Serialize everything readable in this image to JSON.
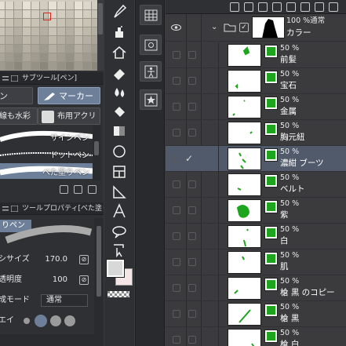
{
  "sub_tool_panel": {
    "title": "サブツール[ペン]"
  },
  "sub_tool_tabs": [
    {
      "label": "ン"
    },
    {
      "label": "マーカー"
    },
    {
      "label": "線も水彩"
    },
    {
      "label": "布用アクリ"
    }
  ],
  "brushes": [
    {
      "label": "サインペン"
    },
    {
      "label": "ドットペン"
    },
    {
      "label": "べた塗りペン"
    }
  ],
  "tool_property": {
    "title": "ツールプロパティ[べた塗りペン]",
    "preview_label": "りペン"
  },
  "properties": {
    "size_label": "シサイズ",
    "size_value": "170.0",
    "opacity_label": "透明度",
    "opacity_value": "100",
    "mode_label": "成モード",
    "mode_value": "通常",
    "aa_label": "エイ"
  },
  "folder": {
    "opacity": "100 %通常",
    "name": "カラー"
  },
  "layers": [
    {
      "opacity": "50 %",
      "name": "前髪",
      "selected": false
    },
    {
      "opacity": "50 %",
      "name": "宝石",
      "selected": false
    },
    {
      "opacity": "50 %",
      "name": "金属",
      "selected": false
    },
    {
      "opacity": "50 %",
      "name": "胸元紐",
      "selected": false
    },
    {
      "opacity": "50 %",
      "name": "濃紺 ブーツ",
      "selected": true
    },
    {
      "opacity": "50 %",
      "name": "ベルト",
      "selected": false
    },
    {
      "opacity": "50 %",
      "name": "紫",
      "selected": false
    },
    {
      "opacity": "50 %",
      "name": "白",
      "selected": false
    },
    {
      "opacity": "50 %",
      "name": "肌",
      "selected": false
    },
    {
      "opacity": "50 %",
      "name": "槍 黒 のコピー",
      "selected": false
    },
    {
      "opacity": "50 %",
      "name": "槍 黒",
      "selected": false
    },
    {
      "opacity": "50 %",
      "name": "槍 白",
      "selected": false
    }
  ],
  "colors": {
    "mask_green": "#1ea51e",
    "selection": "#6d7f99",
    "main_color": "#d8d8d8",
    "sub_color": "#f4e6e6"
  }
}
